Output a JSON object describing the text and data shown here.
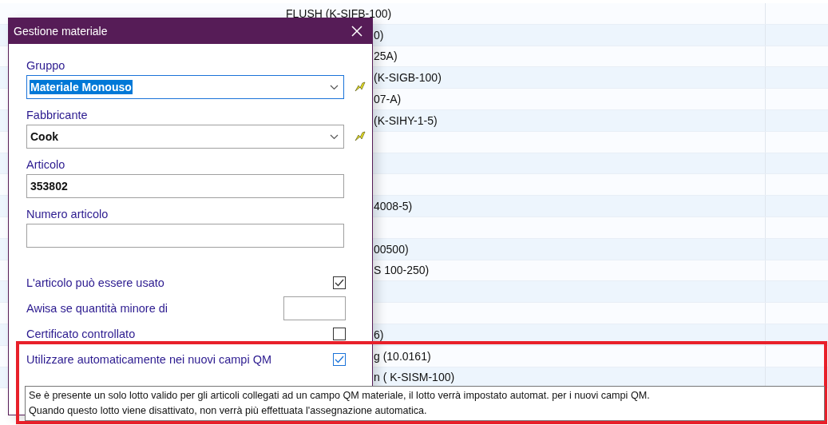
{
  "background_table": {
    "rows": [
      {
        "text": "FLUSH (K-SIFB-100)"
      },
      {
        "text": "0)"
      },
      {
        "text": "25A)"
      },
      {
        "text": "(K-SIGB-100)"
      },
      {
        "text": "07-A)"
      },
      {
        "text": "(K-SIHY-1-5)"
      },
      {},
      {},
      {},
      {
        "text": "4008-5)"
      },
      {},
      {
        "text": "00500)"
      },
      {
        "text": "S 100-250)"
      },
      {},
      {},
      {
        "text": "6)"
      },
      {
        "text": "g (10.0161)"
      },
      {
        "text": "n ( K-SISM-100)"
      }
    ]
  },
  "dialog": {
    "title": "Gestione materiale",
    "fields": [
      {
        "kind": "combo",
        "label": "Gruppo",
        "value": "Materiale Monouso",
        "focused": true
      },
      {
        "kind": "combo",
        "label": "Fabbricante",
        "value": "Cook",
        "focused": false
      },
      {
        "kind": "text",
        "label": "Articolo",
        "value": "353802",
        "focused": false
      },
      {
        "kind": "text",
        "label": "Numero articolo",
        "focused": false
      }
    ],
    "options": [
      {
        "kind": "checkbox",
        "label": "L'articolo può essere usato",
        "checked": true
      },
      {
        "kind": "number",
        "label": "Awisa se quantità minore di"
      },
      {
        "kind": "checkbox",
        "label": "Certificato controllato",
        "checked": false
      },
      {
        "kind": "checkbox",
        "label": "Utilizzare automaticamente nei nuovi campi QM",
        "checked": true,
        "focused": true
      }
    ]
  },
  "tooltip": {
    "lines": [
      "Se è presente un solo lotto valido per gli articoli collegati ad un campo QM materiale, il lotto verrà impostato automat. per i nuovi campi QM.",
      "Quando questo lotto viene disattivato, non verrà più effettuata l'assegnazione automatica."
    ]
  }
}
